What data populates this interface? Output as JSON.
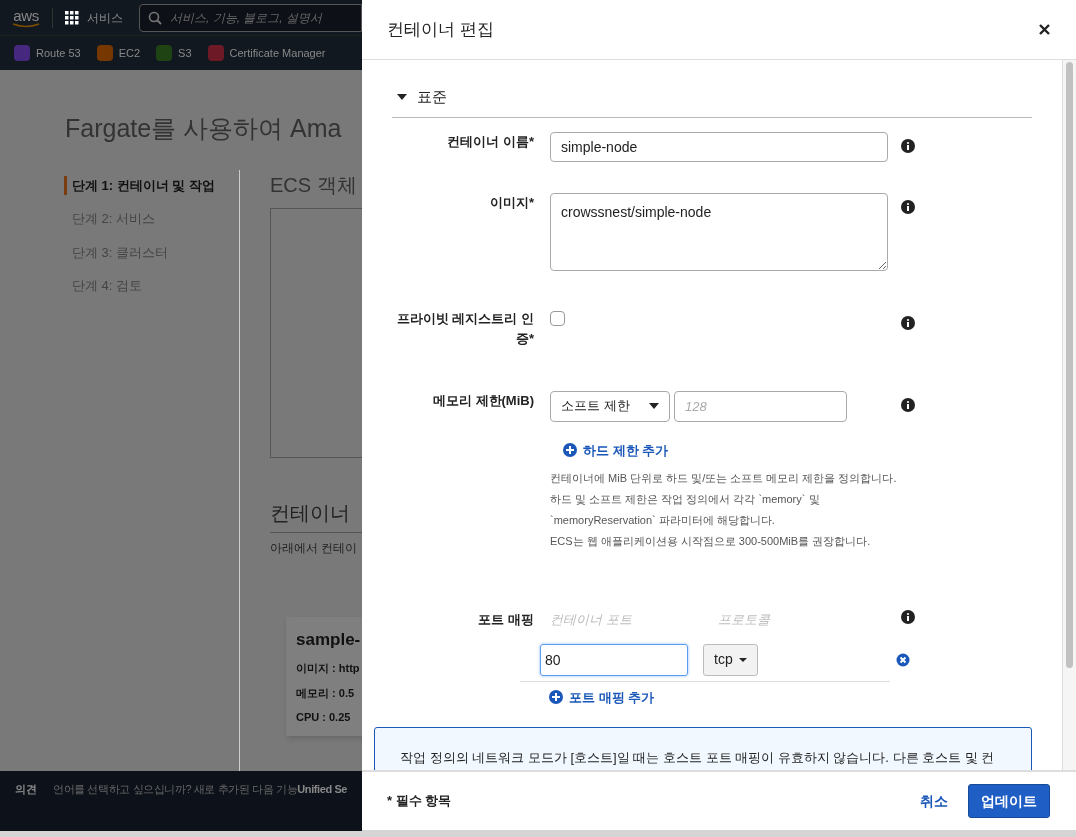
{
  "background": {
    "top_nav": {
      "logo": "aws",
      "services": "서비스",
      "search_placeholder": "서비스, 기능, 블로그, 설명서"
    },
    "favorites": [
      {
        "label": "Route 53",
        "color": "#46287f"
      },
      {
        "label": "EC2",
        "color": "#763800"
      },
      {
        "label": "S3",
        "color": "#1f4312"
      },
      {
        "label": "Certificate Manager",
        "color": "#6e1a26"
      }
    ],
    "page_title": "Fargate를 사용하여 Ama",
    "steps": [
      {
        "label": "단계 1: 컨테이너 및 작업",
        "selected": true
      },
      {
        "label": "단계 2: 서비스",
        "selected": false
      },
      {
        "label": "단계 3: 클러스터",
        "selected": false
      },
      {
        "label": "단계 4: 검토",
        "selected": false
      }
    ],
    "section_title": "ECS 객체",
    "container_section_title": "컨테이너",
    "container_section_text": "아래에서 컨테이",
    "card": {
      "title": "sample-",
      "lines": [
        "이미지 : http",
        "메모리 :  0.5",
        "CPU :  0.25"
      ]
    },
    "footer": {
      "feedback": "의견",
      "message": "언어를 선택하고 싶으십니까? 새로 추가된 다음 기능",
      "message_bold": "Unified Se"
    }
  },
  "modal": {
    "title": "컨테이너 편집",
    "section": {
      "label": "표준",
      "expanded": true
    },
    "fields": [
      {
        "kind": "text",
        "label": "컨테이너 이름*",
        "value": "simple-node"
      },
      {
        "kind": "textarea",
        "label": "이미지*",
        "value": "crowssnest/simple-node"
      },
      {
        "kind": "checkbox",
        "label": "프라이빗 레지스트리 인증*",
        "checked": false
      },
      {
        "kind": "memory",
        "label": "메모리 제한(MiB)",
        "select": "소프트 제한",
        "placeholder": "128",
        "link": "하드 제한 추가",
        "help": [
          "컨테이너에 MiB 단위로 하드 및/또는 소프트 메모리 제한을 정의합니다.",
          "하드 및 소프트 제한은 작업 정의에서 각각 `memory` 및",
          "`memoryReservation` 파라미터에 해당합니다.",
          "ECS는 웹 애플리케이션용 시작점으로 300-500MiB를 권장합니다."
        ]
      }
    ],
    "port_mapping": {
      "label": "포트 매핑",
      "columns": [
        "컨테이너 포트",
        "프로토콜"
      ],
      "rows": [
        {
          "port": "80",
          "protocol": "tcp"
        }
      ],
      "add_link": "포트 매핑 추가"
    },
    "info_box": "작업 정의의 네트워크 모드가 [호스트]일 때는 호스트 포트 매핑이 유효하지 않습니다. 다른 호스트 및 컨",
    "required_note": "* 필수 항목",
    "cancel": "취소",
    "submit": "업데이트"
  }
}
